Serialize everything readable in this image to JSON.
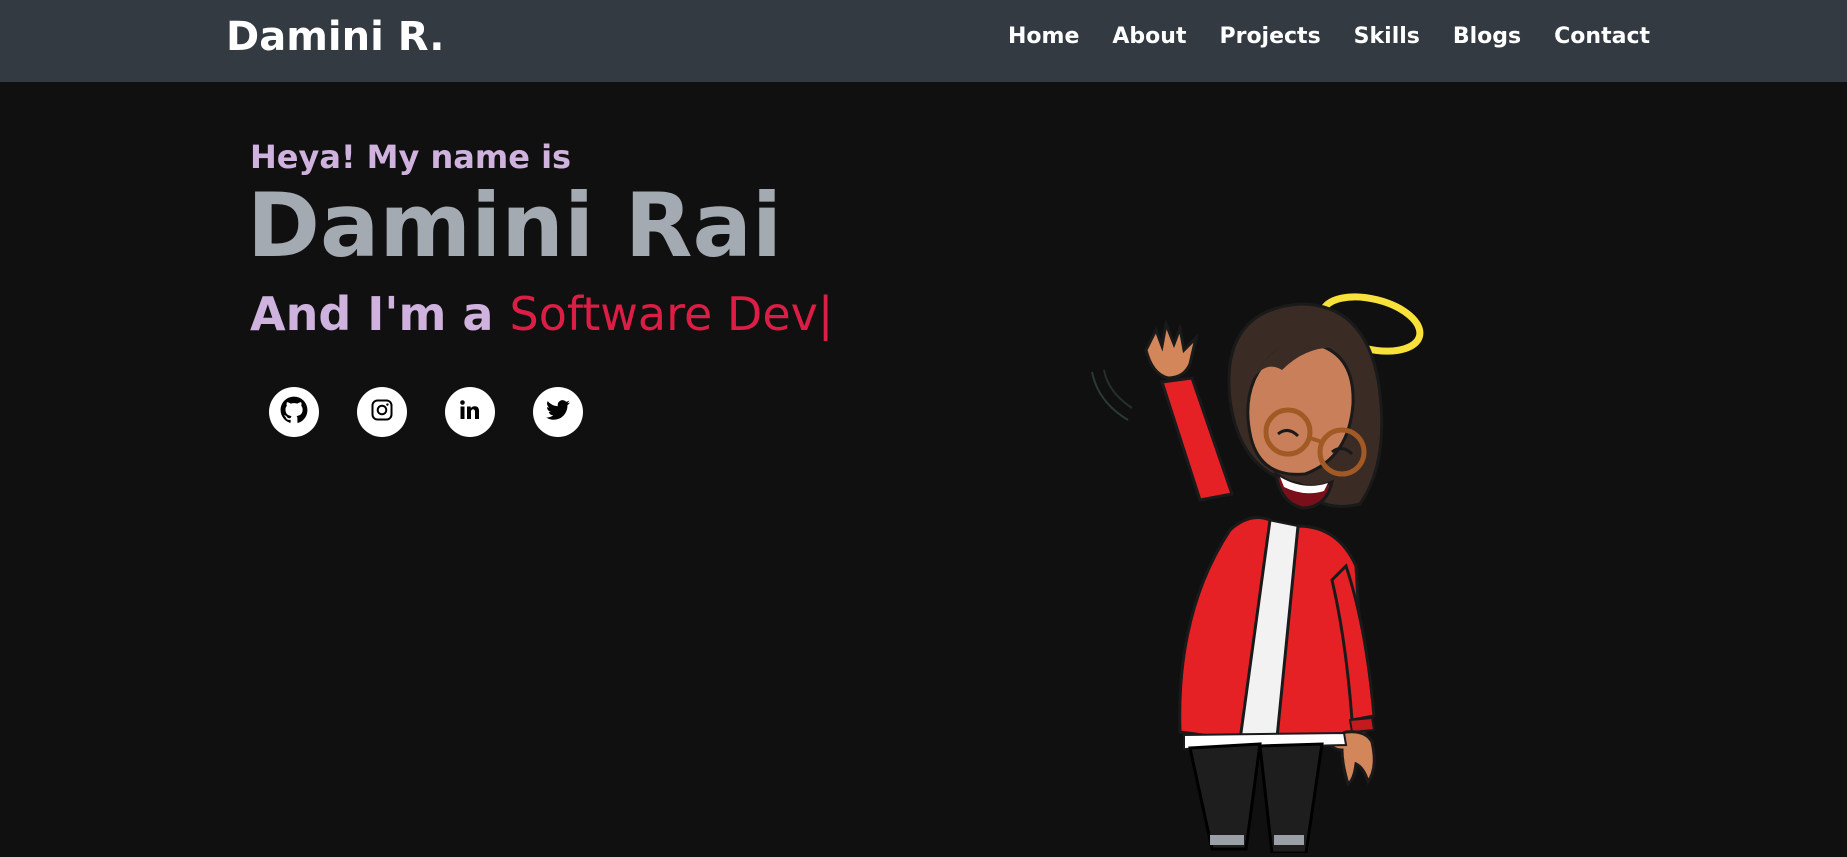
{
  "navbar": {
    "brand": "Damini R.",
    "links": [
      {
        "label": "Home"
      },
      {
        "label": "About"
      },
      {
        "label": "Projects"
      },
      {
        "label": "Skills"
      },
      {
        "label": "Blogs"
      },
      {
        "label": "Contact"
      }
    ]
  },
  "hero": {
    "greeting": "Heya! My name is",
    "name": "Damini Rai",
    "role_prefix": "And I'm a ",
    "role_typed": "Software Dev",
    "cursor": "|"
  },
  "socials": [
    {
      "icon": "github-icon"
    },
    {
      "icon": "instagram-icon"
    },
    {
      "icon": "linkedin-icon"
    },
    {
      "icon": "twitter-icon"
    }
  ],
  "colors": {
    "background": "#101010",
    "navbar": "#343a42",
    "accent_purple": "#cfb3de",
    "name_gray": "#a4aab1",
    "accent_red": "#dc1d45"
  }
}
